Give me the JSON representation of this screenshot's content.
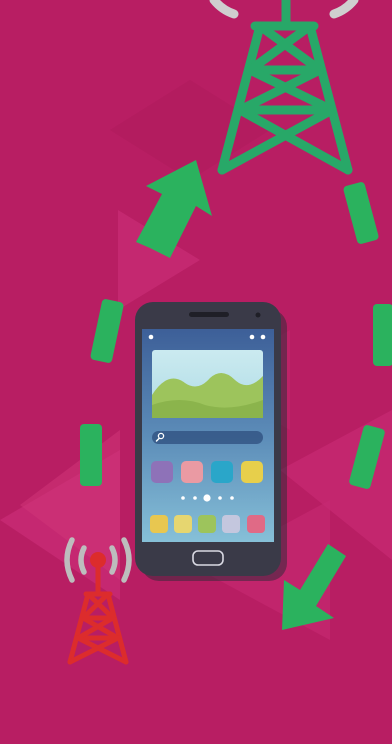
{
  "scene": {
    "description_icons": [
      "tower-top-icon",
      "tower-small-icon",
      "smartphone-icon",
      "wifi-signal-icon",
      "arrow-icon"
    ]
  },
  "colors": {
    "background": "#B81E63",
    "background_shape": "#C72A73",
    "background_shape_dark": "#A91A5B",
    "tower_top": "#28A868",
    "tower_small": "#DC2C2C",
    "arrow": "#2BB25E",
    "signal_arcs": "#BDBDBD",
    "phone_body": "#3A3A48",
    "phone_screen_top": "#3D5F98",
    "phone_screen_bottom": "#86C0D8",
    "picture_sky": "#BEE3EA",
    "picture_hills": "#9DC45C"
  },
  "phone": {
    "home_dots_count": 5,
    "active_dot_index": 2,
    "app_icons_row1": [
      "#8E72B8",
      "#EA9AA3",
      "#2AA6C9",
      "#E7CF4B"
    ],
    "dock_icons": [
      "#E8C750",
      "#E6D670",
      "#9DC45C",
      "#C4C7DE",
      "#E06A86"
    ]
  }
}
